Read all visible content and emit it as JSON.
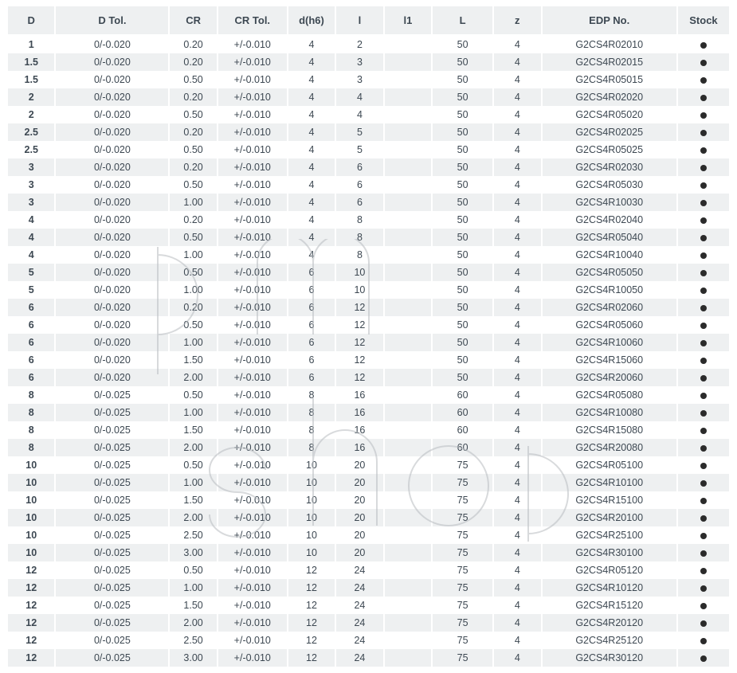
{
  "table": {
    "headers": {
      "D": "D",
      "DTol": "D Tol.",
      "CR": "CR",
      "CRTol": "CR Tol.",
      "dh6": "d(h6)",
      "l": "l",
      "l1": "l1",
      "L": "L",
      "z": "z",
      "EDP": "EDP No.",
      "Stock": "Stock"
    },
    "rows": [
      {
        "D": "1",
        "DTol": "0/-0.020",
        "CR": "0.20",
        "CRTol": "+/-0.010",
        "dh6": "4",
        "l": "2",
        "l1": "",
        "L": "50",
        "z": "4",
        "EDP": "G2CS4R02010",
        "Stock": true
      },
      {
        "D": "1.5",
        "DTol": "0/-0.020",
        "CR": "0.20",
        "CRTol": "+/-0.010",
        "dh6": "4",
        "l": "3",
        "l1": "",
        "L": "50",
        "z": "4",
        "EDP": "G2CS4R02015",
        "Stock": true
      },
      {
        "D": "1.5",
        "DTol": "0/-0.020",
        "CR": "0.50",
        "CRTol": "+/-0.010",
        "dh6": "4",
        "l": "3",
        "l1": "",
        "L": "50",
        "z": "4",
        "EDP": "G2CS4R05015",
        "Stock": true
      },
      {
        "D": "2",
        "DTol": "0/-0.020",
        "CR": "0.20",
        "CRTol": "+/-0.010",
        "dh6": "4",
        "l": "4",
        "l1": "",
        "L": "50",
        "z": "4",
        "EDP": "G2CS4R02020",
        "Stock": true
      },
      {
        "D": "2",
        "DTol": "0/-0.020",
        "CR": "0.50",
        "CRTol": "+/-0.010",
        "dh6": "4",
        "l": "4",
        "l1": "",
        "L": "50",
        "z": "4",
        "EDP": "G2CS4R05020",
        "Stock": true
      },
      {
        "D": "2.5",
        "DTol": "0/-0.020",
        "CR": "0.20",
        "CRTol": "+/-0.010",
        "dh6": "4",
        "l": "5",
        "l1": "",
        "L": "50",
        "z": "4",
        "EDP": "G2CS4R02025",
        "Stock": true
      },
      {
        "D": "2.5",
        "DTol": "0/-0.020",
        "CR": "0.50",
        "CRTol": "+/-0.010",
        "dh6": "4",
        "l": "5",
        "l1": "",
        "L": "50",
        "z": "4",
        "EDP": "G2CS4R05025",
        "Stock": true
      },
      {
        "D": "3",
        "DTol": "0/-0.020",
        "CR": "0.20",
        "CRTol": "+/-0.010",
        "dh6": "4",
        "l": "6",
        "l1": "",
        "L": "50",
        "z": "4",
        "EDP": "G2CS4R02030",
        "Stock": true
      },
      {
        "D": "3",
        "DTol": "0/-0.020",
        "CR": "0.50",
        "CRTol": "+/-0.010",
        "dh6": "4",
        "l": "6",
        "l1": "",
        "L": "50",
        "z": "4",
        "EDP": "G2CS4R05030",
        "Stock": true
      },
      {
        "D": "3",
        "DTol": "0/-0.020",
        "CR": "1.00",
        "CRTol": "+/-0.010",
        "dh6": "4",
        "l": "6",
        "l1": "",
        "L": "50",
        "z": "4",
        "EDP": "G2CS4R10030",
        "Stock": true
      },
      {
        "D": "4",
        "DTol": "0/-0.020",
        "CR": "0.20",
        "CRTol": "+/-0.010",
        "dh6": "4",
        "l": "8",
        "l1": "",
        "L": "50",
        "z": "4",
        "EDP": "G2CS4R02040",
        "Stock": true
      },
      {
        "D": "4",
        "DTol": "0/-0.020",
        "CR": "0.50",
        "CRTol": "+/-0.010",
        "dh6": "4",
        "l": "8",
        "l1": "",
        "L": "50",
        "z": "4",
        "EDP": "G2CS4R05040",
        "Stock": true
      },
      {
        "D": "4",
        "DTol": "0/-0.020",
        "CR": "1.00",
        "CRTol": "+/-0.010",
        "dh6": "4",
        "l": "8",
        "l1": "",
        "L": "50",
        "z": "4",
        "EDP": "G2CS4R10040",
        "Stock": true
      },
      {
        "D": "5",
        "DTol": "0/-0.020",
        "CR": "0.50",
        "CRTol": "+/-0.010",
        "dh6": "6",
        "l": "10",
        "l1": "",
        "L": "50",
        "z": "4",
        "EDP": "G2CS4R05050",
        "Stock": true
      },
      {
        "D": "5",
        "DTol": "0/-0.020",
        "CR": "1.00",
        "CRTol": "+/-0.010",
        "dh6": "6",
        "l": "10",
        "l1": "",
        "L": "50",
        "z": "4",
        "EDP": "G2CS4R10050",
        "Stock": true
      },
      {
        "D": "6",
        "DTol": "0/-0.020",
        "CR": "0.20",
        "CRTol": "+/-0.010",
        "dh6": "6",
        "l": "12",
        "l1": "",
        "L": "50",
        "z": "4",
        "EDP": "G2CS4R02060",
        "Stock": true
      },
      {
        "D": "6",
        "DTol": "0/-0.020",
        "CR": "0.50",
        "CRTol": "+/-0.010",
        "dh6": "6",
        "l": "12",
        "l1": "",
        "L": "50",
        "z": "4",
        "EDP": "G2CS4R05060",
        "Stock": true
      },
      {
        "D": "6",
        "DTol": "0/-0.020",
        "CR": "1.00",
        "CRTol": "+/-0.010",
        "dh6": "6",
        "l": "12",
        "l1": "",
        "L": "50",
        "z": "4",
        "EDP": "G2CS4R10060",
        "Stock": true
      },
      {
        "D": "6",
        "DTol": "0/-0.020",
        "CR": "1.50",
        "CRTol": "+/-0.010",
        "dh6": "6",
        "l": "12",
        "l1": "",
        "L": "50",
        "z": "4",
        "EDP": "G2CS4R15060",
        "Stock": true
      },
      {
        "D": "6",
        "DTol": "0/-0.020",
        "CR": "2.00",
        "CRTol": "+/-0.010",
        "dh6": "6",
        "l": "12",
        "l1": "",
        "L": "50",
        "z": "4",
        "EDP": "G2CS4R20060",
        "Stock": true
      },
      {
        "D": "8",
        "DTol": "0/-0.025",
        "CR": "0.50",
        "CRTol": "+/-0.010",
        "dh6": "8",
        "l": "16",
        "l1": "",
        "L": "60",
        "z": "4",
        "EDP": "G2CS4R05080",
        "Stock": true
      },
      {
        "D": "8",
        "DTol": "0/-0.025",
        "CR": "1.00",
        "CRTol": "+/-0.010",
        "dh6": "8",
        "l": "16",
        "l1": "",
        "L": "60",
        "z": "4",
        "EDP": "G2CS4R10080",
        "Stock": true
      },
      {
        "D": "8",
        "DTol": "0/-0.025",
        "CR": "1.50",
        "CRTol": "+/-0.010",
        "dh6": "8",
        "l": "16",
        "l1": "",
        "L": "60",
        "z": "4",
        "EDP": "G2CS4R15080",
        "Stock": true
      },
      {
        "D": "8",
        "DTol": "0/-0.025",
        "CR": "2.00",
        "CRTol": "+/-0.010",
        "dh6": "8",
        "l": "16",
        "l1": "",
        "L": "60",
        "z": "4",
        "EDP": "G2CS4R20080",
        "Stock": true
      },
      {
        "D": "10",
        "DTol": "0/-0.025",
        "CR": "0.50",
        "CRTol": "+/-0.010",
        "dh6": "10",
        "l": "20",
        "l1": "",
        "L": "75",
        "z": "4",
        "EDP": "G2CS4R05100",
        "Stock": true
      },
      {
        "D": "10",
        "DTol": "0/-0.025",
        "CR": "1.00",
        "CRTol": "+/-0.010",
        "dh6": "10",
        "l": "20",
        "l1": "",
        "L": "75",
        "z": "4",
        "EDP": "G2CS4R10100",
        "Stock": true
      },
      {
        "D": "10",
        "DTol": "0/-0.025",
        "CR": "1.50",
        "CRTol": "+/-0.010",
        "dh6": "10",
        "l": "20",
        "l1": "",
        "L": "75",
        "z": "4",
        "EDP": "G2CS4R15100",
        "Stock": true
      },
      {
        "D": "10",
        "DTol": "0/-0.025",
        "CR": "2.00",
        "CRTol": "+/-0.010",
        "dh6": "10",
        "l": "20",
        "l1": "",
        "L": "75",
        "z": "4",
        "EDP": "G2CS4R20100",
        "Stock": true
      },
      {
        "D": "10",
        "DTol": "0/-0.025",
        "CR": "2.50",
        "CRTol": "+/-0.010",
        "dh6": "10",
        "l": "20",
        "l1": "",
        "L": "75",
        "z": "4",
        "EDP": "G2CS4R25100",
        "Stock": true
      },
      {
        "D": "10",
        "DTol": "0/-0.025",
        "CR": "3.00",
        "CRTol": "+/-0.010",
        "dh6": "10",
        "l": "20",
        "l1": "",
        "L": "75",
        "z": "4",
        "EDP": "G2CS4R30100",
        "Stock": true
      },
      {
        "D": "12",
        "DTol": "0/-0.025",
        "CR": "0.50",
        "CRTol": "+/-0.010",
        "dh6": "12",
        "l": "24",
        "l1": "",
        "L": "75",
        "z": "4",
        "EDP": "G2CS4R05120",
        "Stock": true
      },
      {
        "D": "12",
        "DTol": "0/-0.025",
        "CR": "1.00",
        "CRTol": "+/-0.010",
        "dh6": "12",
        "l": "24",
        "l1": "",
        "L": "75",
        "z": "4",
        "EDP": "G2CS4R10120",
        "Stock": true
      },
      {
        "D": "12",
        "DTol": "0/-0.025",
        "CR": "1.50",
        "CRTol": "+/-0.010",
        "dh6": "12",
        "l": "24",
        "l1": "",
        "L": "75",
        "z": "4",
        "EDP": "G2CS4R15120",
        "Stock": true
      },
      {
        "D": "12",
        "DTol": "0/-0.025",
        "CR": "2.00",
        "CRTol": "+/-0.010",
        "dh6": "12",
        "l": "24",
        "l1": "",
        "L": "75",
        "z": "4",
        "EDP": "G2CS4R20120",
        "Stock": true
      },
      {
        "D": "12",
        "DTol": "0/-0.025",
        "CR": "2.50",
        "CRTol": "+/-0.010",
        "dh6": "12",
        "l": "24",
        "l1": "",
        "L": "75",
        "z": "4",
        "EDP": "G2CS4R25120",
        "Stock": true
      },
      {
        "D": "12",
        "DTol": "0/-0.025",
        "CR": "3.00",
        "CRTol": "+/-0.010",
        "dh6": "12",
        "l": "24",
        "l1": "",
        "L": "75",
        "z": "4",
        "EDP": "G2CS4R30120",
        "Stock": true
      }
    ]
  },
  "watermark": "pm shop"
}
